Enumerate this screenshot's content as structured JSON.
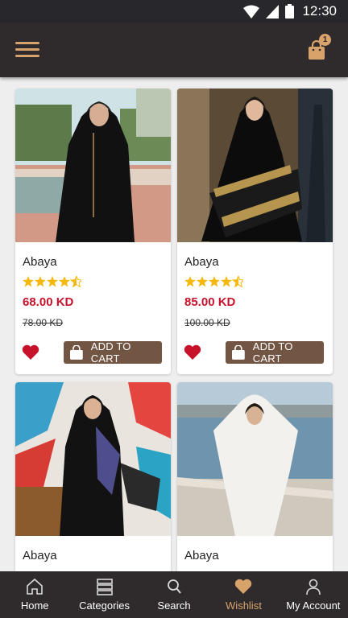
{
  "status_bar": {
    "time": "12:30"
  },
  "header": {
    "cart_count": "1"
  },
  "colors": {
    "accent": "#d8a36b",
    "price": "#c7122c",
    "add_to_cart_bg": "#725543",
    "bar_bg": "#2f2a2c",
    "star": "#f5b80f"
  },
  "products": [
    {
      "name": "Abaya",
      "rating": 4.5,
      "price": "68.00 KD",
      "old_price": "78.00 KD",
      "add_to_cart": "ADD TO CART"
    },
    {
      "name": "Abaya",
      "rating": 4.5,
      "price": "85.00 KD",
      "old_price": "100.00 KD",
      "add_to_cart": "ADD TO CART"
    },
    {
      "name": "Abaya"
    },
    {
      "name": "Abaya"
    }
  ],
  "bottom_nav": [
    {
      "label": "Home",
      "icon": "home-icon"
    },
    {
      "label": "Categories",
      "icon": "categories-icon"
    },
    {
      "label": "Search",
      "icon": "search-icon"
    },
    {
      "label": "Wishlist",
      "icon": "heart-icon",
      "active": true
    },
    {
      "label": "My Account",
      "icon": "user-icon"
    }
  ]
}
